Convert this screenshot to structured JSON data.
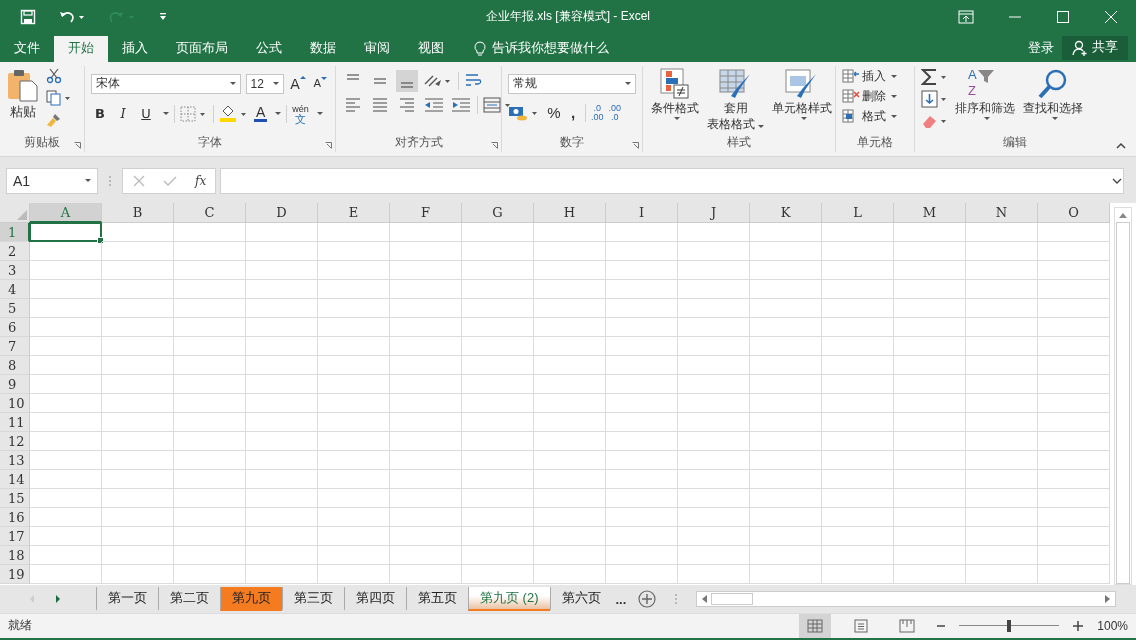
{
  "window": {
    "title": "企业年报.xls  [兼容模式] - Excel"
  },
  "menu_tabs": [
    {
      "label": "文件",
      "selected": false
    },
    {
      "label": "开始",
      "selected": true
    },
    {
      "label": "插入",
      "selected": false
    },
    {
      "label": "页面布局",
      "selected": false
    },
    {
      "label": "公式",
      "selected": false
    },
    {
      "label": "数据",
      "selected": false
    },
    {
      "label": "审阅",
      "selected": false
    },
    {
      "label": "视图",
      "selected": false
    }
  ],
  "tell_me": "告诉我你想要做什么",
  "sign_in": "登录",
  "share": "共享",
  "ribbon": {
    "clipboard": {
      "label": "剪贴板",
      "paste": "粘贴"
    },
    "font": {
      "label": "字体",
      "font_name": "宋体",
      "font_size": "12",
      "grow": "A",
      "shrink": "A",
      "bold": "B",
      "italic": "I",
      "underline": "U",
      "font_color": "A",
      "phonetic_top": "wén",
      "phonetic_bottom": "文"
    },
    "alignment": {
      "label": "对齐方式"
    },
    "number": {
      "label": "数字",
      "format": "常规",
      "percent": "%",
      "comma": ",",
      "inc_top": ".0",
      "inc_bottom": ".00",
      "dec_top": ".00",
      "dec_bottom": ".0"
    },
    "styles": {
      "label": "样式",
      "conditional": "条件格式",
      "table_top": "套用",
      "table_bottom": "表格格式",
      "cell_styles": "单元格样式"
    },
    "cells": {
      "label": "单元格",
      "items": [
        {
          "kind": "insert",
          "label": "插入"
        },
        {
          "kind": "delete",
          "label": "删除"
        },
        {
          "kind": "format",
          "label": "格式"
        }
      ]
    },
    "editing": {
      "label": "编辑",
      "sort_top": "A",
      "sort_bottom": "Z",
      "sort": "排序和筛选",
      "find": "查找和选择"
    }
  },
  "formula_bar": {
    "name_box": "A1",
    "fx": "fx"
  },
  "sheet": {
    "columns": [
      {
        "label": "A",
        "selected": true
      },
      {
        "label": "B",
        "selected": false
      },
      {
        "label": "C",
        "selected": false
      },
      {
        "label": "D",
        "selected": false
      },
      {
        "label": "E",
        "selected": false
      },
      {
        "label": "F",
        "selected": false
      },
      {
        "label": "G",
        "selected": false
      },
      {
        "label": "H",
        "selected": false
      },
      {
        "label": "I",
        "selected": false
      },
      {
        "label": "J",
        "selected": false
      },
      {
        "label": "K",
        "selected": false
      },
      {
        "label": "L",
        "selected": false
      },
      {
        "label": "M",
        "selected": false
      },
      {
        "label": "N",
        "selected": false
      },
      {
        "label": "O",
        "selected": false
      }
    ],
    "rows": [
      {
        "label": "1",
        "selected": true
      },
      {
        "label": "2",
        "selected": false
      },
      {
        "label": "3",
        "selected": false
      },
      {
        "label": "4",
        "selected": false
      },
      {
        "label": "5",
        "selected": false
      },
      {
        "label": "6",
        "selected": false
      },
      {
        "label": "7",
        "selected": false
      },
      {
        "label": "8",
        "selected": false
      },
      {
        "label": "9",
        "selected": false
      },
      {
        "label": "10",
        "selected": false
      },
      {
        "label": "11",
        "selected": false
      },
      {
        "label": "12",
        "selected": false
      },
      {
        "label": "13",
        "selected": false
      },
      {
        "label": "14",
        "selected": false
      },
      {
        "label": "15",
        "selected": false
      },
      {
        "label": "16",
        "selected": false
      },
      {
        "label": "17",
        "selected": false
      },
      {
        "label": "18",
        "selected": false
      },
      {
        "label": "19",
        "selected": false
      }
    ]
  },
  "sheet_tabs": [
    {
      "label": "第一页",
      "selected": false
    },
    {
      "label": "第二页",
      "selected": false
    },
    {
      "label": "第九页",
      "selected": false,
      "color": "#f47b20"
    },
    {
      "label": "第三页",
      "selected": false
    },
    {
      "label": "第四页",
      "selected": false
    },
    {
      "label": "第五页",
      "selected": false
    },
    {
      "label": "第九页 (2)",
      "selected": true,
      "color": "#f47b20"
    },
    {
      "label": "第六页",
      "selected": false
    }
  ],
  "more_tabs": "...",
  "status_bar": {
    "text": "就绪",
    "views": [
      {
        "kind": "normal",
        "selected": true
      },
      {
        "kind": "page_layout",
        "selected": false
      },
      {
        "kind": "page_break",
        "selected": false
      }
    ],
    "zoom": {
      "level": 0.5,
      "reading": "100%"
    }
  }
}
